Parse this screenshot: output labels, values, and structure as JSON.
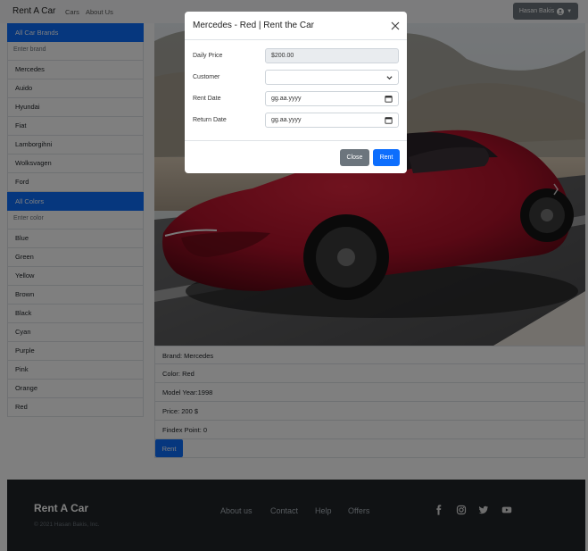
{
  "navbar": {
    "brand": "Rent A Car",
    "links": [
      "Cars",
      "About Us"
    ],
    "user": "Hasan Bakis"
  },
  "brands": {
    "header": "All Car Brands",
    "placeholder": "Enter brand",
    "items": [
      "Mercedes",
      "Auido",
      "Hyundai",
      "Fiat",
      "Lamborgihni",
      "Wolksvagen",
      "Ford"
    ]
  },
  "colors": {
    "header": "All Colors",
    "placeholder": "Enter color",
    "items": [
      "Blue",
      "Green",
      "Yellow",
      "Brown",
      "Black",
      "Cyan",
      "Purple",
      "Pink",
      "Orange",
      "Red"
    ]
  },
  "details": [
    "Brand: Mercedes",
    "Color: Red",
    "Model Year:1998",
    "Price: 200 $",
    "Findex Point: 0"
  ],
  "rent_button": "Rent",
  "footer": {
    "brand": "Rent A Car",
    "copyright": "© 2021 Hasan Bakis, Inc.",
    "links": [
      "About us",
      "Contact",
      "Help",
      "Offers"
    ],
    "icons": [
      "facebook-icon",
      "instagram-icon",
      "twitter-icon",
      "youtube-icon"
    ]
  },
  "modal": {
    "title": "Mercedes - Red | Rent the Car",
    "daily_price_label": "Daily Price",
    "daily_price_value": "$200.00",
    "customer_label": "Customer",
    "rent_date_label": "Rent Date",
    "rent_date_placeholder": "gg.aa.yyyy",
    "return_date_label": "Return Date",
    "return_date_placeholder": "gg.aa.yyyy",
    "close_button": "Close",
    "rent_button": "Rent"
  },
  "colors_theme": {
    "primary": "#0d6efd",
    "secondary": "#6c757d",
    "footer": "#212529",
    "car": "#b3122a"
  }
}
